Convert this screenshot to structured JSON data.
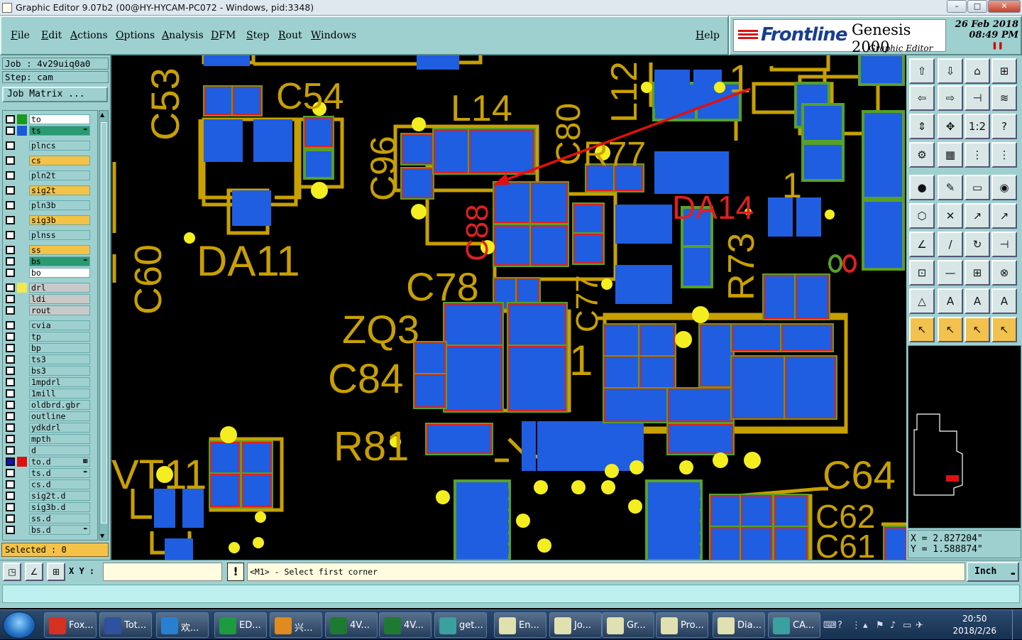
{
  "window": {
    "title": "Graphic Editor 9.07b2 (00@HY-HYCAM-PC072 - Windows, pid:3348)",
    "controls": [
      "–",
      "□",
      "✕"
    ]
  },
  "menu": {
    "items": [
      "File",
      "Edit",
      "Actions",
      "Options",
      "Analysis",
      "DFM",
      "Step",
      "Rout",
      "Windows"
    ],
    "help": "Help"
  },
  "brand": {
    "logo": "Frontline",
    "product": "Genesis 2000",
    "subtitle": "Graphic Editor",
    "date": "26 Feb 2018",
    "time": "08:49 PM"
  },
  "job": {
    "job_label": "Job : 4v29uiq0a0",
    "step_label": "Step: cam",
    "matrix_button": "Job Matrix ..."
  },
  "layers": [
    {
      "name": "to",
      "swatch": "#1a9a1a",
      "bg": "#ffffff",
      "checked": false
    },
    {
      "name": "ts",
      "swatch": "#1a5ad8",
      "bg": "#2a9a72",
      "checked": false,
      "mark": "✒"
    },
    {
      "name": "plncs",
      "swatch": "",
      "bg": "#9fd0d0",
      "checked": false
    },
    {
      "name": "cs",
      "swatch": "",
      "bg": "#f4c246",
      "checked": false
    },
    {
      "name": "pln2t",
      "swatch": "",
      "bg": "#9fd0d0",
      "checked": false
    },
    {
      "name": "sig2t",
      "swatch": "",
      "bg": "#f4c246",
      "checked": false
    },
    {
      "name": "pln3b",
      "swatch": "",
      "bg": "#9fd0d0",
      "checked": false
    },
    {
      "name": "sig3b",
      "swatch": "",
      "bg": "#f4c246",
      "checked": false
    },
    {
      "name": "plnss",
      "swatch": "",
      "bg": "#9fd0d0",
      "checked": false
    },
    {
      "name": "ss",
      "swatch": "",
      "bg": "#f4c246",
      "checked": false
    },
    {
      "name": "bs",
      "swatch": "",
      "bg": "#2a9a72",
      "checked": false,
      "mark": "✒"
    },
    {
      "name": "bo",
      "swatch": "",
      "bg": "#ffffff",
      "checked": false
    },
    {
      "name": "drl",
      "swatch": "#f2e84a",
      "bg": "#c9c9c9",
      "checked": false
    },
    {
      "name": "ldi",
      "swatch": "",
      "bg": "#c9c9c9",
      "checked": false
    },
    {
      "name": "rout",
      "swatch": "",
      "bg": "#c9c9c9",
      "checked": false
    },
    {
      "name": "cvia",
      "swatch": "",
      "bg": "#9fd0d0",
      "checked": false
    },
    {
      "name": "tp",
      "swatch": "",
      "bg": "#9fd0d0",
      "checked": false
    },
    {
      "name": "bp",
      "swatch": "",
      "bg": "#9fd0d0",
      "checked": false
    },
    {
      "name": "ts3",
      "swatch": "",
      "bg": "#9fd0d0",
      "checked": false
    },
    {
      "name": "bs3",
      "swatch": "",
      "bg": "#9fd0d0",
      "checked": false
    },
    {
      "name": "1mpdrl",
      "swatch": "",
      "bg": "#9fd0d0",
      "checked": false
    },
    {
      "name": "1mill",
      "swatch": "",
      "bg": "#9fd0d0",
      "checked": false
    },
    {
      "name": "oldbrd.gbr",
      "swatch": "",
      "bg": "#9fd0d0",
      "checked": false
    },
    {
      "name": "outline",
      "swatch": "",
      "bg": "#9fd0d0",
      "checked": false
    },
    {
      "name": "ydkdrl",
      "swatch": "",
      "bg": "#9fd0d0",
      "checked": false
    },
    {
      "name": "mpth",
      "swatch": "",
      "bg": "#9fd0d0",
      "checked": false
    },
    {
      "name": "d",
      "swatch": "",
      "bg": "#9fd0d0",
      "checked": false
    },
    {
      "name": "to.d",
      "swatch": "#e01010",
      "bg": "#9fd0d0",
      "checked": true,
      "mark": "▦"
    },
    {
      "name": "ts.d",
      "swatch": "",
      "bg": "#9fd0d0",
      "checked": false,
      "mark": "✒"
    },
    {
      "name": "cs.d",
      "swatch": "",
      "bg": "#9fd0d0",
      "checked": false
    },
    {
      "name": "sig2t.d",
      "swatch": "",
      "bg": "#9fd0d0",
      "checked": false
    },
    {
      "name": "sig3b.d",
      "swatch": "",
      "bg": "#9fd0d0",
      "checked": false
    },
    {
      "name": "ss.d",
      "swatch": "",
      "bg": "#9fd0d0",
      "checked": false
    },
    {
      "name": "bs.d",
      "swatch": "",
      "bg": "#9fd0d0",
      "checked": false,
      "mark": "✒"
    }
  ],
  "selected": "Selected : 0",
  "pcb": {
    "silk_color": "#c8a000",
    "pad_color": "#1f5ee0",
    "mask_color": "#58a028",
    "edge_color": "#e02020",
    "via_color": "#f4ee20",
    "refdes": [
      "C53",
      "C54",
      "L14",
      "C80",
      "L12",
      "C96",
      "R77",
      "C88",
      "DA14",
      "DA11",
      "C60",
      "R73",
      "C78",
      "ZQ3",
      "C77",
      "C84",
      "R81",
      "VT11",
      "C64",
      "C62",
      "C61",
      "1",
      "1",
      "1"
    ]
  },
  "toolbox": {
    "buttons": [
      "⇧",
      "⇩",
      "⌂",
      "⊞",
      "⇦",
      "⇨",
      "⊣",
      "≋",
      "⇕",
      "✥",
      "1:2",
      "?",
      "⚙",
      "▦",
      "⋮",
      "⋮",
      "●",
      "✎",
      "▭",
      "◉",
      "⬡",
      "✕",
      "↗",
      "↗",
      "∠",
      "/",
      "↻",
      "⊣",
      "⊡",
      "—",
      "⊞",
      "⊗",
      "△",
      "A",
      "A",
      "A",
      "↖",
      "↖",
      "↖",
      "↖"
    ]
  },
  "coordinates": {
    "x": "X = 2.827204\"",
    "y": "Y = 1.588874\""
  },
  "command": {
    "xy_label": "X Y :",
    "xy_value": "",
    "prompt": "<M1> - Select first corner",
    "units": "Inch"
  },
  "taskbar": {
    "items": [
      {
        "label": "Fox...",
        "color": "#d63020"
      },
      {
        "label": "Tot...",
        "color": "#3050a0"
      },
      {
        "label": "欢...",
        "color": "#2a80d0"
      },
      {
        "label": "ED...",
        "color": "#1e9a40"
      },
      {
        "label": "兴...",
        "color": "#e08a20"
      },
      {
        "label": "4V...",
        "color": "#1e7a30"
      },
      {
        "label": "4V...",
        "color": "#1e7a30"
      },
      {
        "label": "get...",
        "color": "#3aa0a0"
      },
      {
        "label": "En...",
        "color": "#e0e0b0"
      },
      {
        "label": "Jo...",
        "color": "#e0e0b0"
      },
      {
        "label": "Gr...",
        "color": "#e0e0b0"
      },
      {
        "label": "Pro...",
        "color": "#e0e0b0"
      },
      {
        "label": "Dia...",
        "color": "#e0e0b0"
      },
      {
        "label": "CA...",
        "color": "#3aa0a0"
      }
    ],
    "time": "20:50",
    "date": "2018/2/26"
  }
}
